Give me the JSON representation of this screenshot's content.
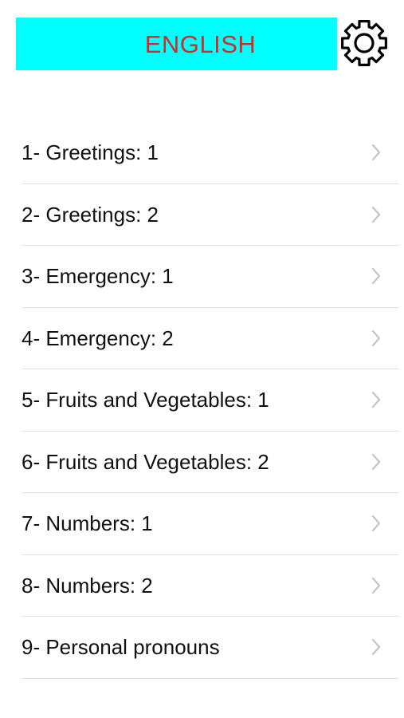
{
  "header": {
    "title": "ENGLISH",
    "banner_color": "#00ffff",
    "title_color": "#d42a2a",
    "settings_icon": "gear-icon"
  },
  "lessons": [
    {
      "label": "1- Greetings: 1"
    },
    {
      "label": "2- Greetings: 2"
    },
    {
      "label": "3- Emergency: 1"
    },
    {
      "label": "4- Emergency: 2"
    },
    {
      "label": "5- Fruits and Vegetables: 1"
    },
    {
      "label": "6- Fruits and Vegetables: 2"
    },
    {
      "label": "7- Numbers: 1"
    },
    {
      "label": "8- Numbers: 2"
    },
    {
      "label": "9- Personal pronouns"
    }
  ],
  "row_icon": "chevron-right-icon"
}
